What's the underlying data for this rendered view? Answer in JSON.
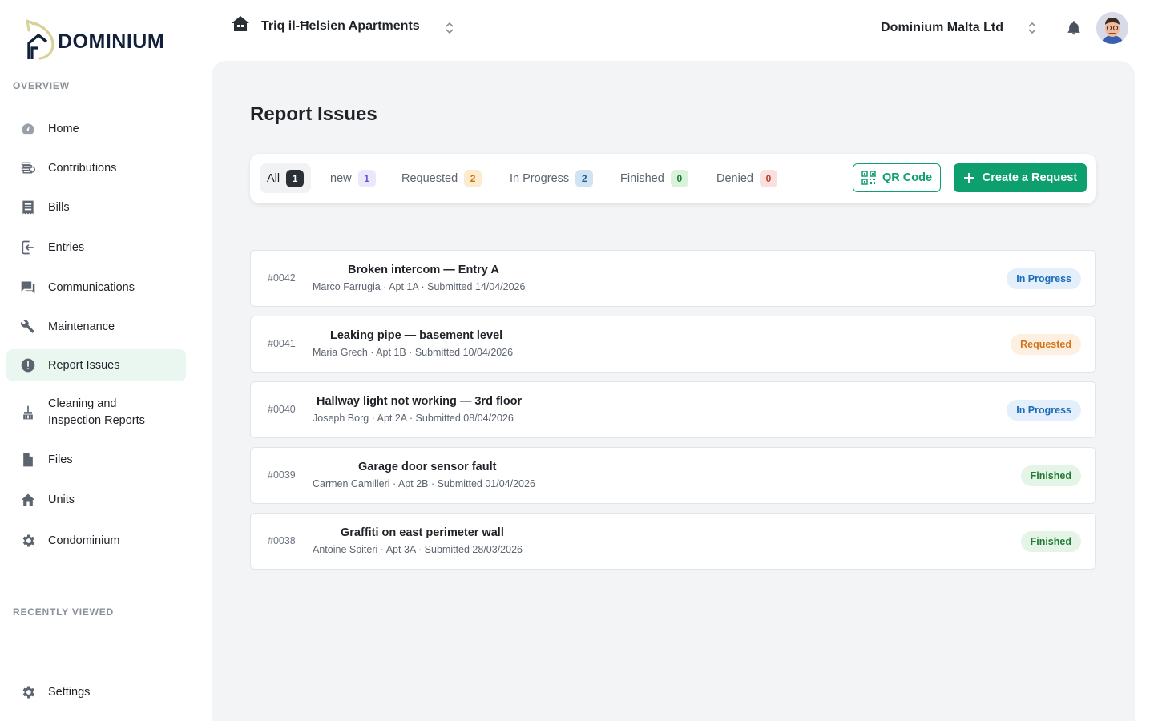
{
  "brand": {
    "name": "DOMINIUM",
    "accent": "#0e9f6e"
  },
  "sidebar": {
    "overview_label": "OVERVIEW",
    "recent_label": "RECENTLY VIEWED",
    "items": [
      {
        "label": "Home",
        "icon": "gauge-icon"
      },
      {
        "label": "Contributions",
        "icon": "coins-icon"
      },
      {
        "label": "Bills",
        "icon": "receipt-icon"
      },
      {
        "label": "Entries",
        "icon": "entry-icon"
      },
      {
        "label": "Communications",
        "icon": "chat-icon"
      },
      {
        "label": "Maintenance",
        "icon": "wrench-icon"
      },
      {
        "label": "Report Issues",
        "icon": "alert-icon"
      },
      {
        "label": "Cleaning and Inspection Reports",
        "icon": "broom-icon"
      },
      {
        "label": "Files",
        "icon": "file-icon"
      },
      {
        "label": "Units",
        "icon": "house-icon"
      },
      {
        "label": "Condominium",
        "icon": "gear-icon"
      }
    ],
    "settings_label": "Settings"
  },
  "topbar": {
    "property": "Triq il-Ħelsien Apartments",
    "company": "Dominium Malta Ltd"
  },
  "page": {
    "title": "Report Issues"
  },
  "filters": {
    "tabs": [
      {
        "label": "All",
        "count": "1"
      },
      {
        "label": "new",
        "count": "1"
      },
      {
        "label": "Requested",
        "count": "2"
      },
      {
        "label": "In Progress",
        "count": "2"
      },
      {
        "label": "Finished",
        "count": "0"
      },
      {
        "label": "Denied",
        "count": "0"
      }
    ],
    "qr_label": "QR Code",
    "create_label": "Create a Request"
  },
  "issues": [
    {
      "id": "#0042",
      "title": "Broken intercom — Entry A",
      "meta": "Marco Farrugia · Apt 1A · Submitted 14/04/2026",
      "status": "In Progress"
    },
    {
      "id": "#0041",
      "title": "Leaking pipe — basement level",
      "meta": "Maria Grech · Apt 1B · Submitted 10/04/2026",
      "status": "Requested"
    },
    {
      "id": "#0040",
      "title": "Hallway light not working — 3rd floor",
      "meta": "Joseph Borg · Apt 2A · Submitted 08/04/2026",
      "status": "In Progress"
    },
    {
      "id": "#0039",
      "title": "Garage door sensor fault",
      "meta": "Carmen Camilleri · Apt 2B · Submitted 01/04/2026",
      "status": "Finished"
    },
    {
      "id": "#0038",
      "title": "Graffiti on east perimeter wall",
      "meta": "Antoine Spiteri · Apt 3A · Submitted 28/03/2026",
      "status": "Finished"
    }
  ]
}
